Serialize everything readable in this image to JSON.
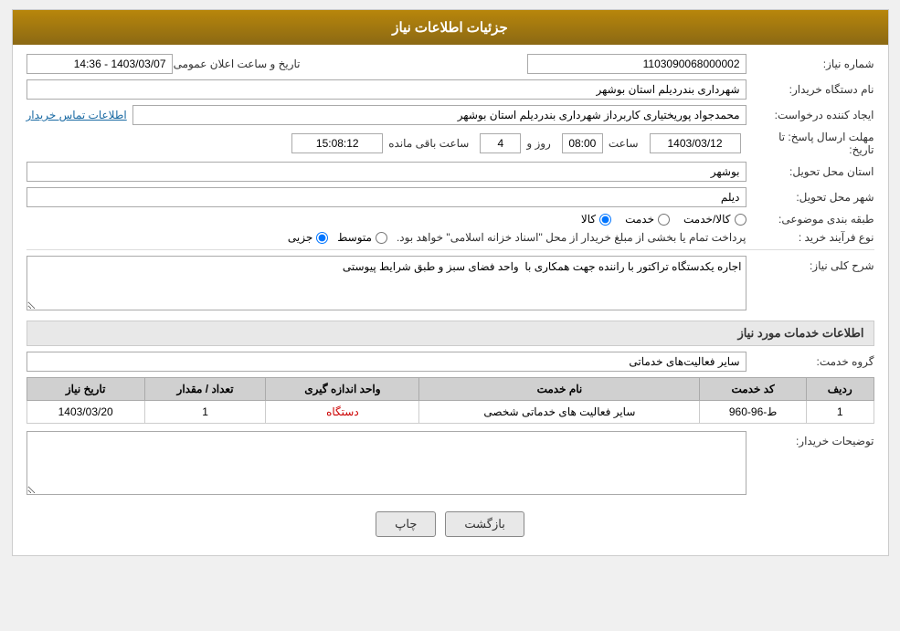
{
  "header": {
    "title": "جزئیات اطلاعات نیاز"
  },
  "fields": {
    "shomare_niaz_label": "شماره نیاز:",
    "shomare_niaz_value": "1103090068000002",
    "name_dastgah_label": "نام دستگاه خریدار:",
    "name_dastgah_value": "شهرداری بندردیلم استان بوشهر",
    "ejad_label": "ایجاد کننده درخواست:",
    "ejad_value": "محمدجواد پوریختیاری کاربرداز شهرداری بندردیلم استان بوشهر",
    "ejad_link": "اطلاعات تماس خریدار",
    "mohlat_label": "مهلت ارسال پاسخ: تا تاریخ:",
    "mohlat_date": "1403/03/12",
    "mohlat_saat_label": "ساعت",
    "mohlat_saat_value": "08:00",
    "mohlat_rooz_label": "روز و",
    "mohlat_rooz_value": "4",
    "mohlat_saat_mande_label": "ساعت باقی مانده",
    "mohlat_saat_mande_value": "15:08:12",
    "ostan_label": "استان محل تحویل:",
    "ostan_value": "بوشهر",
    "shahr_label": "شهر محل تحویل:",
    "shahr_value": "دیلم",
    "tasnif_label": "طبقه بندی موضوعی:",
    "tasnif_kala": "کالا",
    "tasnif_khedmat": "خدمت",
    "tasnif_kala_khedmat": "کالا/خدمت",
    "tarikhe_elam_label": "تاریخ و ساعت اعلان عمومی:",
    "tarikhe_elam_value": "1403/03/07 - 14:36",
    "nooe_farayand_label": "نوع فرآیند خرید :",
    "nooe_jozei": "جزیی",
    "nooe_motavaset": "متوسط",
    "nooe_note": "پرداخت تمام یا بخشی از مبلغ خریدار از محل \"اسناد خزانه اسلامی\" خواهد بود.",
    "sharh_label": "شرح کلی نیاز:",
    "sharh_value": "اجاره یکدستگاه تراکتور با راننده جهت همکاری با  واحد فضای سبز و طبق شرایط پیوستی",
    "khadamat_label": "اطلاعات خدمات مورد نیاز",
    "grooh_label": "گروه خدمت:",
    "grooh_value": "سایر فعالیت‌های خدماتی",
    "table": {
      "headers": [
        "ردیف",
        "کد خدمت",
        "نام خدمت",
        "واحد اندازه گیری",
        "تعداد / مقدار",
        "تاریخ نیاز"
      ],
      "rows": [
        {
          "radif": "1",
          "code": "ط-96-960",
          "name": "سایر فعالیت های خدماتی شخصی",
          "vahed": "دستگاه",
          "tedad": "1",
          "tarikh": "1403/03/20",
          "vahed_color": "red"
        }
      ]
    },
    "tozihat_label": "توضیحات خریدار:",
    "tozihat_value": ""
  },
  "buttons": {
    "print": "چاپ",
    "back": "بازگشت"
  }
}
